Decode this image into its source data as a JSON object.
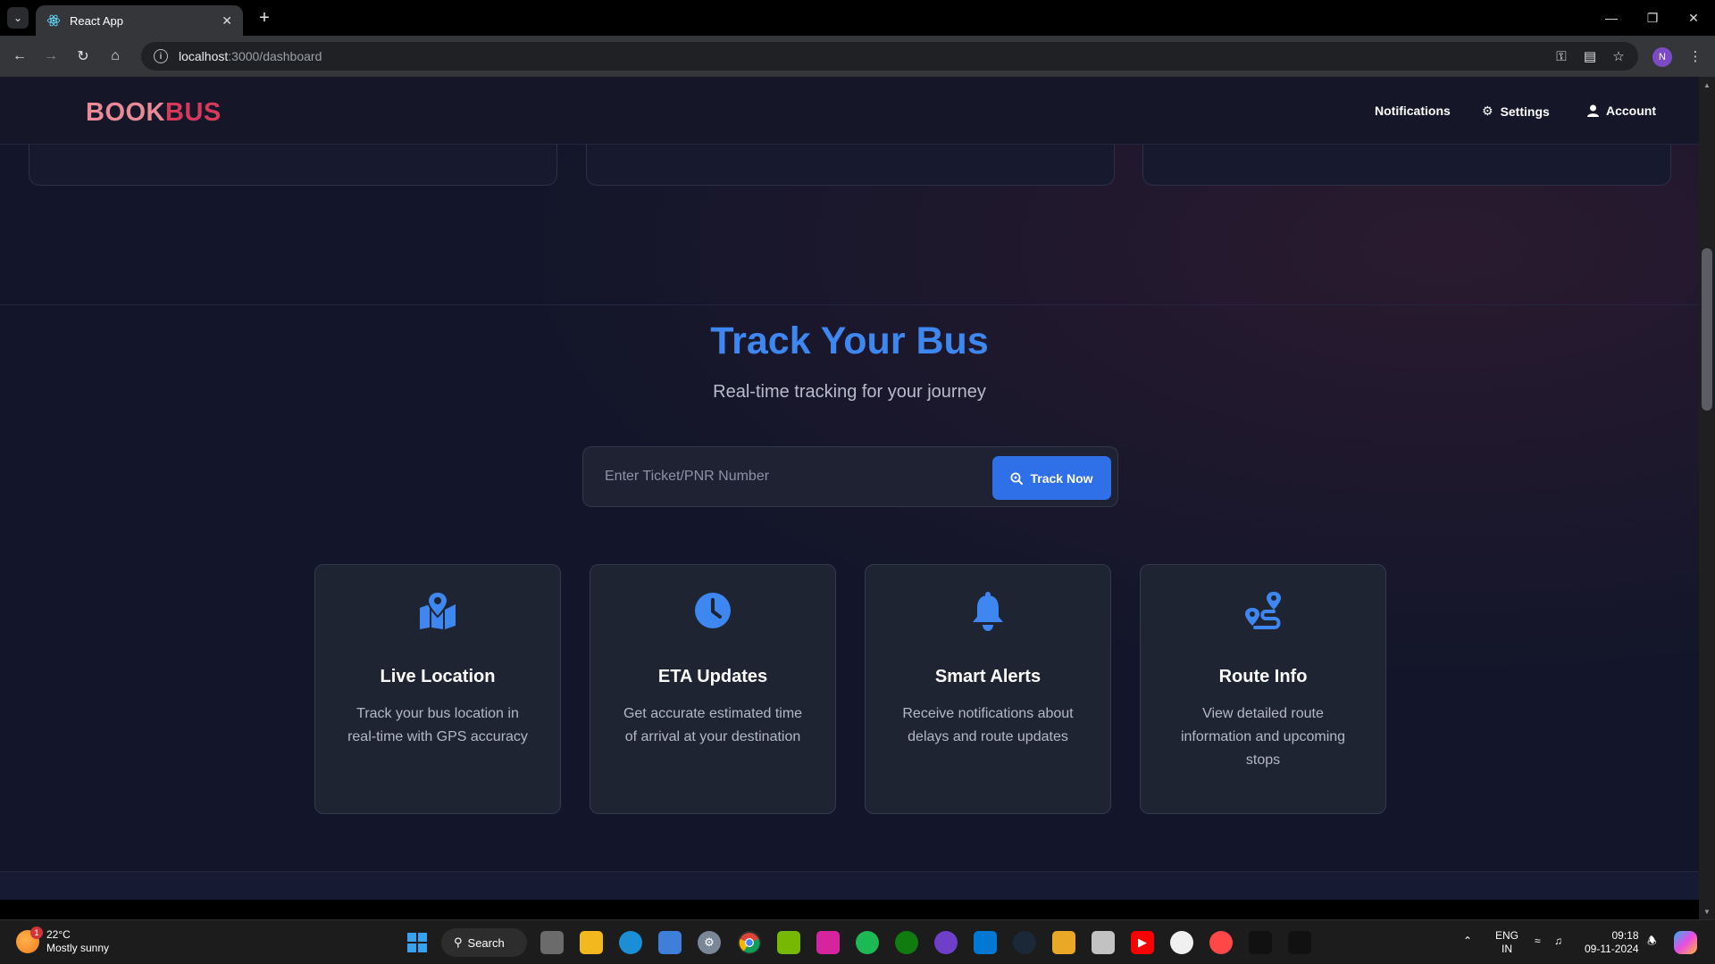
{
  "browser": {
    "tab_title": "React App",
    "url_host": "localhost",
    "url_path": ":3000/dashboard",
    "profile_initial": "N"
  },
  "header": {
    "logo_part1": "BOOK",
    "logo_part2": "BUS",
    "nav": {
      "notifications": "Notifications",
      "settings": "Settings",
      "account": "Account"
    }
  },
  "track": {
    "title": "Track Your Bus",
    "subtitle": "Real-time tracking for your journey",
    "input_placeholder": "Enter Ticket/PNR Number",
    "button_label": "Track Now"
  },
  "features": [
    {
      "icon": "map-location-icon",
      "title": "Live Location",
      "desc": "Track your bus location in real-time with GPS accuracy"
    },
    {
      "icon": "clock-icon",
      "title": "ETA Updates",
      "desc": "Get accurate estimated time of arrival at your destination"
    },
    {
      "icon": "bell-icon",
      "title": "Smart Alerts",
      "desc": "Receive notifications about delays and route updates"
    },
    {
      "icon": "route-icon",
      "title": "Route Info",
      "desc": "View detailed route information and upcoming stops"
    }
  ],
  "colors": {
    "accent": "#3f87f0",
    "brand_light": "#e98a96",
    "brand_dark": "#d7395a",
    "button": "#2f6fe8"
  },
  "taskbar": {
    "weather_temp": "22°C",
    "weather_desc": "Mostly sunny",
    "weather_badge": "1",
    "search_label": "Search",
    "lang_top": "ENG",
    "lang_bottom": "IN",
    "time": "09:18",
    "date": "09-11-2024"
  }
}
